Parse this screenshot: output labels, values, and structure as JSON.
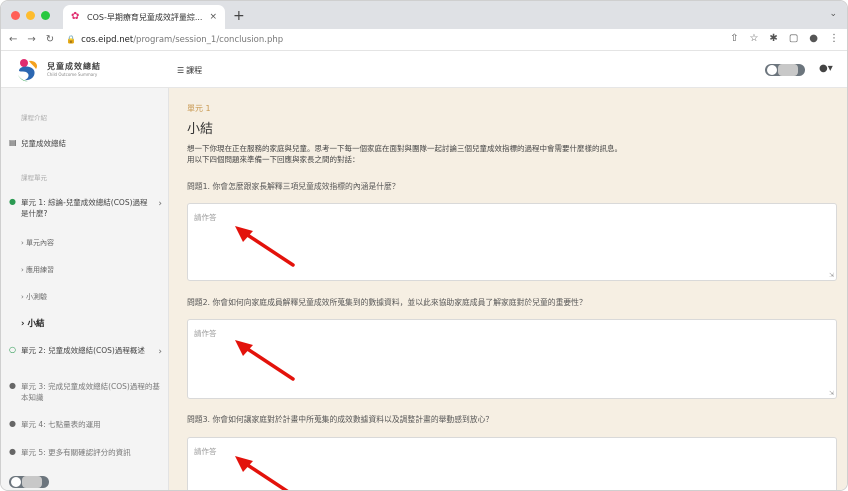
{
  "browser": {
    "tab_title": "COS-早期療育兒童成效評量綜...",
    "tab_close": "×",
    "new_tab": "+",
    "url_host": "cos.eipd.net",
    "url_path": "/program/session_1/conclusion.php"
  },
  "header": {
    "logo_cn": "兒童成效總結",
    "logo_en": "Child Outcome Summary",
    "menu_label": "課程"
  },
  "sidebar": {
    "section1_heading": "課程介紹",
    "intro_item": "兒童成效總結",
    "section2_heading": "課程單元",
    "units": [
      {
        "label": "單元 1: 綜論-兒童成效總結(COS)過程是什麼?"
      },
      {
        "label": "單元 2: 兒童成效總結(COS)過程概述"
      },
      {
        "label": "單元 3: 完成兒童成效總結(COS)過程的基本知識"
      },
      {
        "label": "單元 4: 七點量表的運用"
      },
      {
        "label": "單元 5: 更多有關確認評分的資訊"
      }
    ],
    "sub_items": [
      "單元內容",
      "應用練習",
      "小測驗"
    ],
    "active_sub": "小結"
  },
  "main": {
    "unit_label": "單元 1",
    "title": "小結",
    "intro_line1": "想一下你現在正在服務的家庭與兒童。思考一下每一個家庭在面對與團隊一起討論三個兒童成效指標的過程中會需要什麼樣的訊息。",
    "intro_line2": "用以下四個問題來準備一下回應與家長之間的對話：",
    "questions": [
      {
        "text": "問題1. 你會怎麼跟家長解釋三項兒童成效指標的內涵是什麼？",
        "placeholder": "請作答"
      },
      {
        "text": "問題2. 你會如何向家庭成員解釋兒童成效所蒐集到的數據資料，並以此來協助家庭成員了解家庭對於兒童的重要性？",
        "placeholder": "請作答"
      },
      {
        "text": "問題3. 你會如何讓家庭對於計畫中所蒐集的成效數據資料以及調整計畫的舉動感到放心？",
        "placeholder": "請作答"
      }
    ]
  },
  "colors": {
    "accent": "#c99a53",
    "arrow": "#e3120b",
    "brand_pink": "#e02d6f",
    "main_bg": "#f6efe3"
  }
}
